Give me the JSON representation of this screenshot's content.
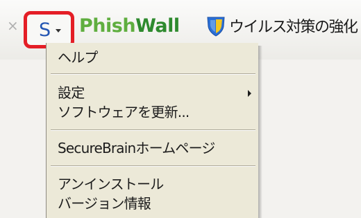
{
  "toolbar": {
    "close_glyph": "×",
    "menu_button_glyph": "S",
    "brand_part1": "Phish",
    "brand_part2": "Wall",
    "virus_label": "ウイルス対策の強化"
  },
  "menu": {
    "items": [
      {
        "label": "ヘルプ"
      },
      {
        "label": "設定"
      },
      {
        "label": "ソフトウェアを更新..."
      },
      {
        "label": "SecureBrainホームページ"
      },
      {
        "label": "アンインストール"
      },
      {
        "label": "バージョン情報"
      }
    ]
  },
  "colors": {
    "highlight_border": "#e41e26",
    "s_logo": "#2456b3",
    "brand_light_green": "#5fae3f",
    "brand_dark_green": "#2e8a2e",
    "shield_blue": "#2a6fd6",
    "shield_yellow": "#f3c623",
    "menu_background": "#ece9d8"
  },
  "icons": {
    "menu_button": "s-logo-icon",
    "dropdown": "chevron-down-icon",
    "shield": "shield-icon",
    "submenu": "chevron-right-icon"
  }
}
